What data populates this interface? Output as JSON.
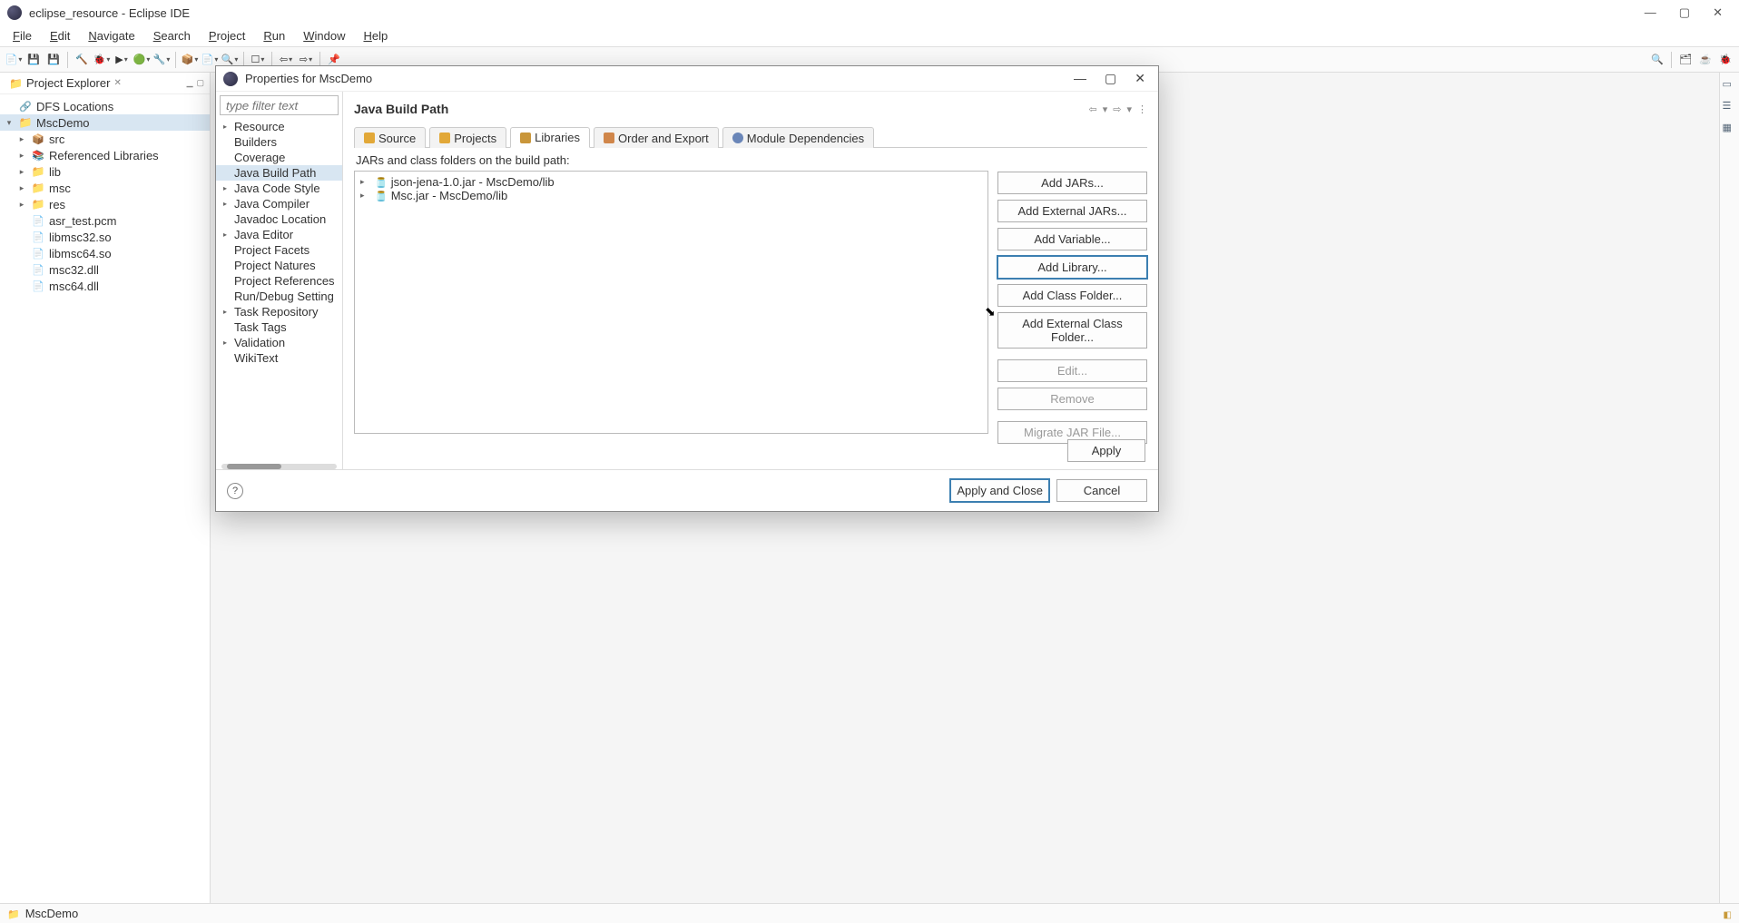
{
  "titlebar": {
    "title": "eclipse_resource - Eclipse IDE",
    "min": "—",
    "max": "▢",
    "close": "✕"
  },
  "menubar": [
    "File",
    "Edit",
    "Navigate",
    "Search",
    "Project",
    "Run",
    "Window",
    "Help"
  ],
  "project_explorer": {
    "title": "Project Explorer",
    "close": "✕",
    "items": [
      {
        "level": 0,
        "arrow": "",
        "icon": "nav",
        "label": "DFS Locations"
      },
      {
        "level": 0,
        "arrow": "▾",
        "icon": "javaproj",
        "label": "MscDemo",
        "selected": true
      },
      {
        "level": 1,
        "arrow": "▸",
        "icon": "src",
        "label": "src"
      },
      {
        "level": 1,
        "arrow": "▸",
        "icon": "lib",
        "label": "Referenced Libraries"
      },
      {
        "level": 1,
        "arrow": "▸",
        "icon": "folder",
        "label": "lib"
      },
      {
        "level": 1,
        "arrow": "▸",
        "icon": "folder",
        "label": "msc"
      },
      {
        "level": 1,
        "arrow": "▸",
        "icon": "folder",
        "label": "res"
      },
      {
        "level": 1,
        "arrow": "",
        "icon": "file",
        "label": "asr_test.pcm"
      },
      {
        "level": 1,
        "arrow": "",
        "icon": "file",
        "label": "libmsc32.so"
      },
      {
        "level": 1,
        "arrow": "",
        "icon": "file",
        "label": "libmsc64.so"
      },
      {
        "level": 1,
        "arrow": "",
        "icon": "file",
        "label": "msc32.dll"
      },
      {
        "level": 1,
        "arrow": "",
        "icon": "file",
        "label": "msc64.dll"
      }
    ]
  },
  "dialog": {
    "title": "Properties for MscDemo",
    "min": "—",
    "max": "▢",
    "close": "✕",
    "filter_placeholder": "type filter text",
    "categories": [
      {
        "arrow": "▸",
        "label": "Resource"
      },
      {
        "arrow": "",
        "label": "Builders"
      },
      {
        "arrow": "",
        "label": "Coverage"
      },
      {
        "arrow": "",
        "label": "Java Build Path",
        "selected": true
      },
      {
        "arrow": "▸",
        "label": "Java Code Style"
      },
      {
        "arrow": "▸",
        "label": "Java Compiler"
      },
      {
        "arrow": "",
        "label": "Javadoc Location"
      },
      {
        "arrow": "▸",
        "label": "Java Editor"
      },
      {
        "arrow": "",
        "label": "Project Facets"
      },
      {
        "arrow": "",
        "label": "Project Natures"
      },
      {
        "arrow": "",
        "label": "Project References"
      },
      {
        "arrow": "",
        "label": "Run/Debug Setting"
      },
      {
        "arrow": "▸",
        "label": "Task Repository"
      },
      {
        "arrow": "",
        "label": "Task Tags"
      },
      {
        "arrow": "▸",
        "label": "Validation"
      },
      {
        "arrow": "",
        "label": "WikiText"
      }
    ],
    "page_title": "Java Build Path",
    "nav": {
      "back": "⇦",
      "back_drop": "▾",
      "fwd": "⇨",
      "fwd_drop": "▾",
      "menu": "⋮"
    },
    "tabs": [
      {
        "icon": "src",
        "label": "Source"
      },
      {
        "icon": "proj",
        "label": "Projects"
      },
      {
        "icon": "lib",
        "label": "Libraries",
        "active": true
      },
      {
        "icon": "ord",
        "label": "Order and Export"
      },
      {
        "icon": "mod",
        "label": "Module Dependencies"
      }
    ],
    "jars_label": "JARs and class folders on the build path:",
    "jars": [
      {
        "label": "json-jena-1.0.jar - MscDemo/lib"
      },
      {
        "label": "Msc.jar - MscDemo/lib"
      }
    ],
    "buttons": {
      "add_jars": "Add JARs...",
      "add_ext_jars": "Add External JARs...",
      "add_variable": "Add Variable...",
      "add_library": "Add Library...",
      "add_class_folder": "Add Class Folder...",
      "add_ext_class_folder": "Add External Class Folder...",
      "edit": "Edit...",
      "remove": "Remove",
      "migrate": "Migrate JAR File...",
      "apply": "Apply",
      "apply_close": "Apply and Close",
      "cancel": "Cancel"
    }
  },
  "statusbar": {
    "item": "MscDemo"
  }
}
